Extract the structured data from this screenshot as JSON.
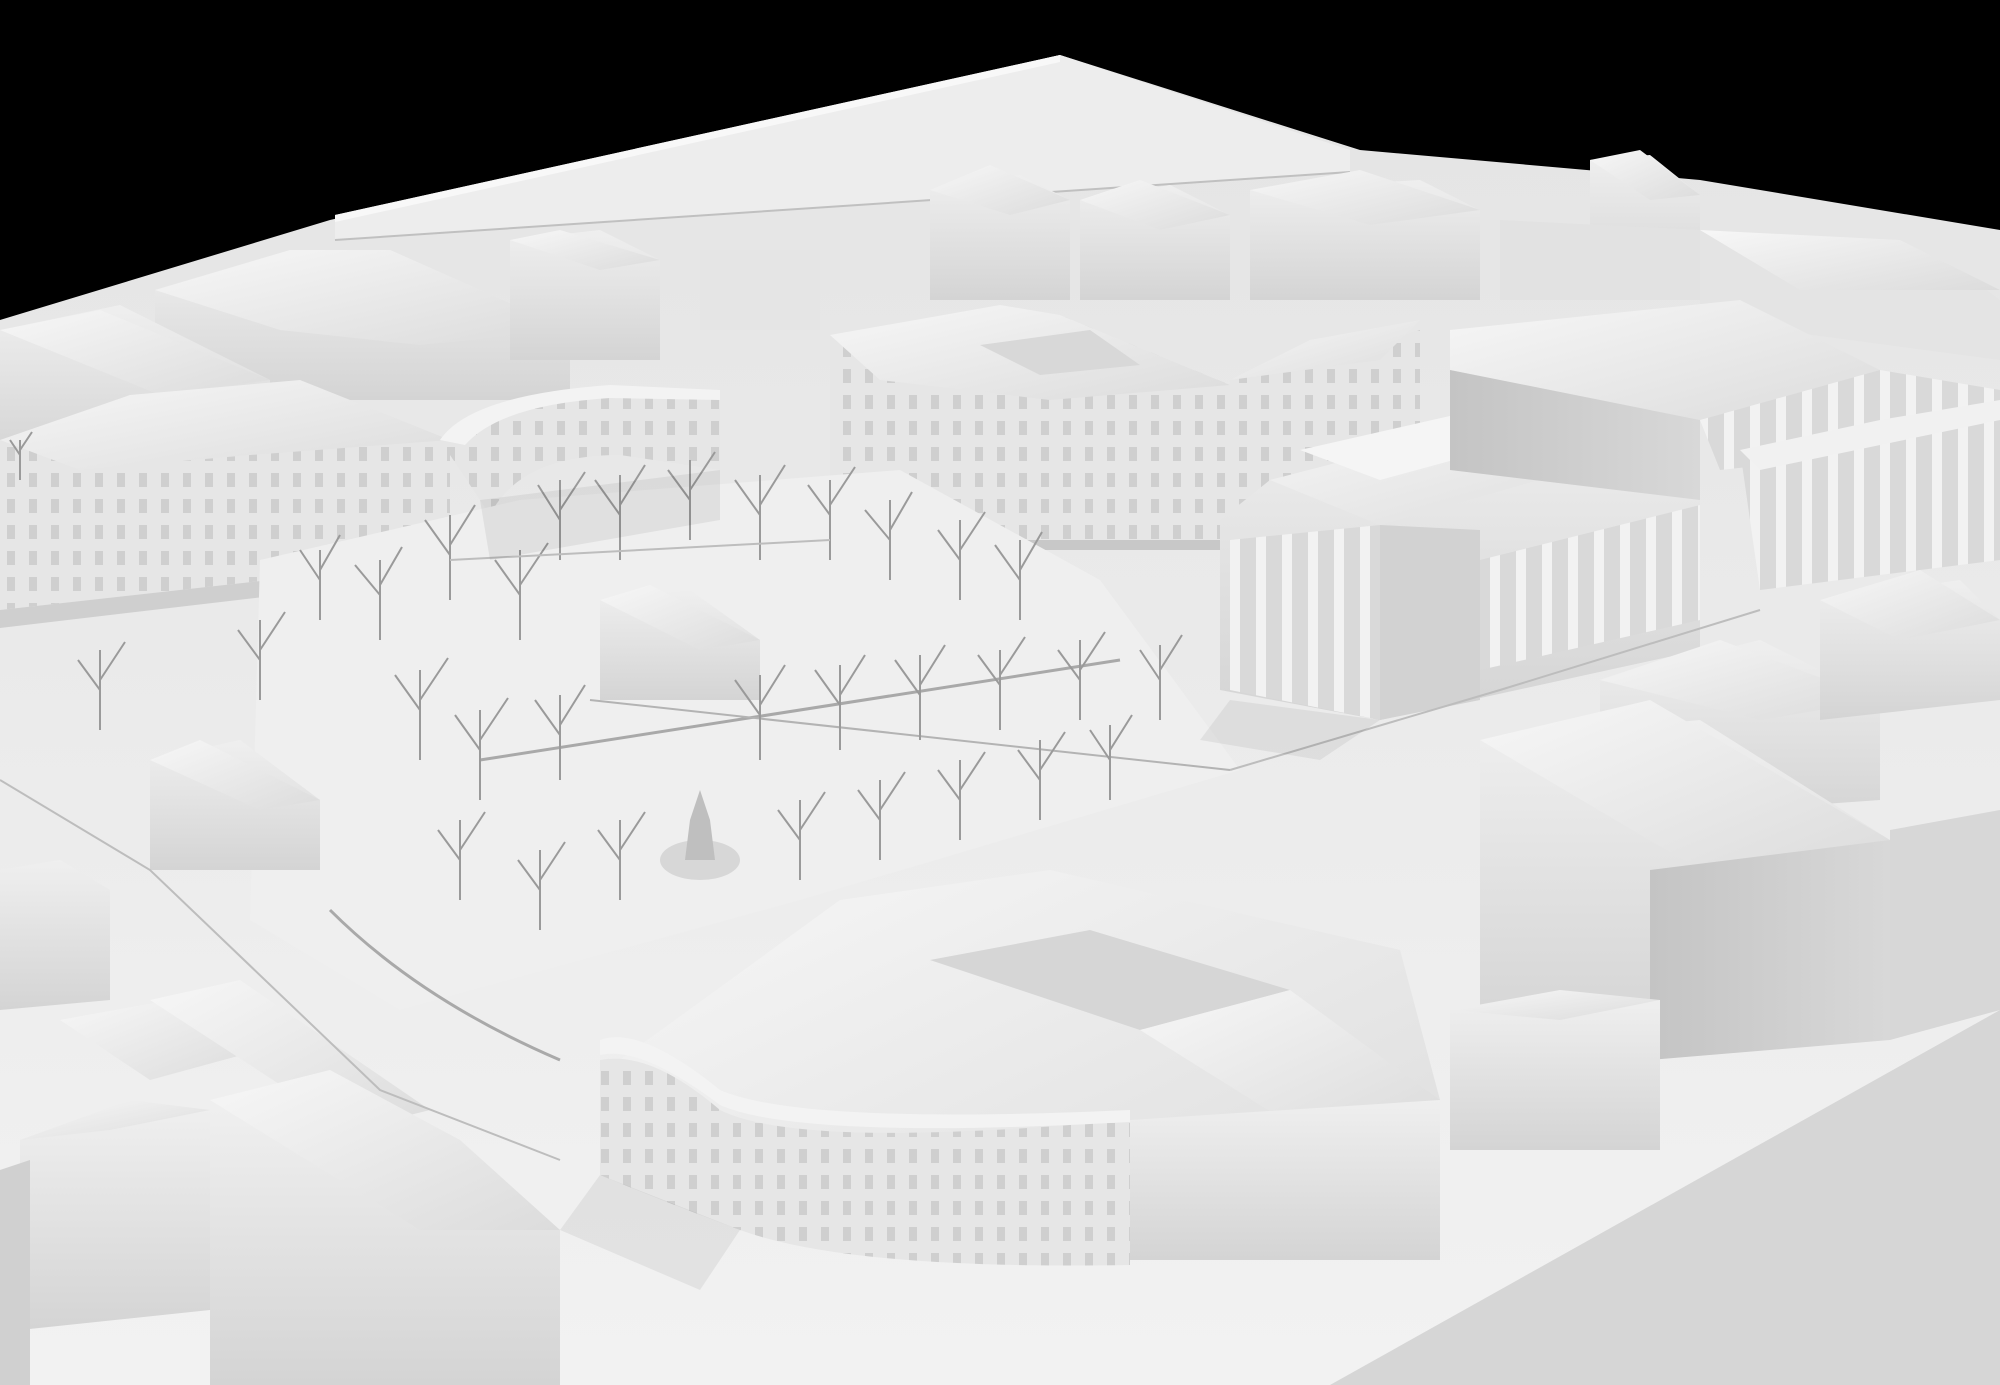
{
  "scene": {
    "subject": "architectural-white-model",
    "colors": {
      "background": "#000000",
      "base": "#e9e9e9",
      "roof_light": "#f4f4f4",
      "roof_mid": "#dedede",
      "wall_light": "#ececec",
      "wall_shade": "#c9c9c9",
      "shadow": "#b9b9b9",
      "tree": "#9a9a9a",
      "line": "#8a8a8a"
    }
  }
}
